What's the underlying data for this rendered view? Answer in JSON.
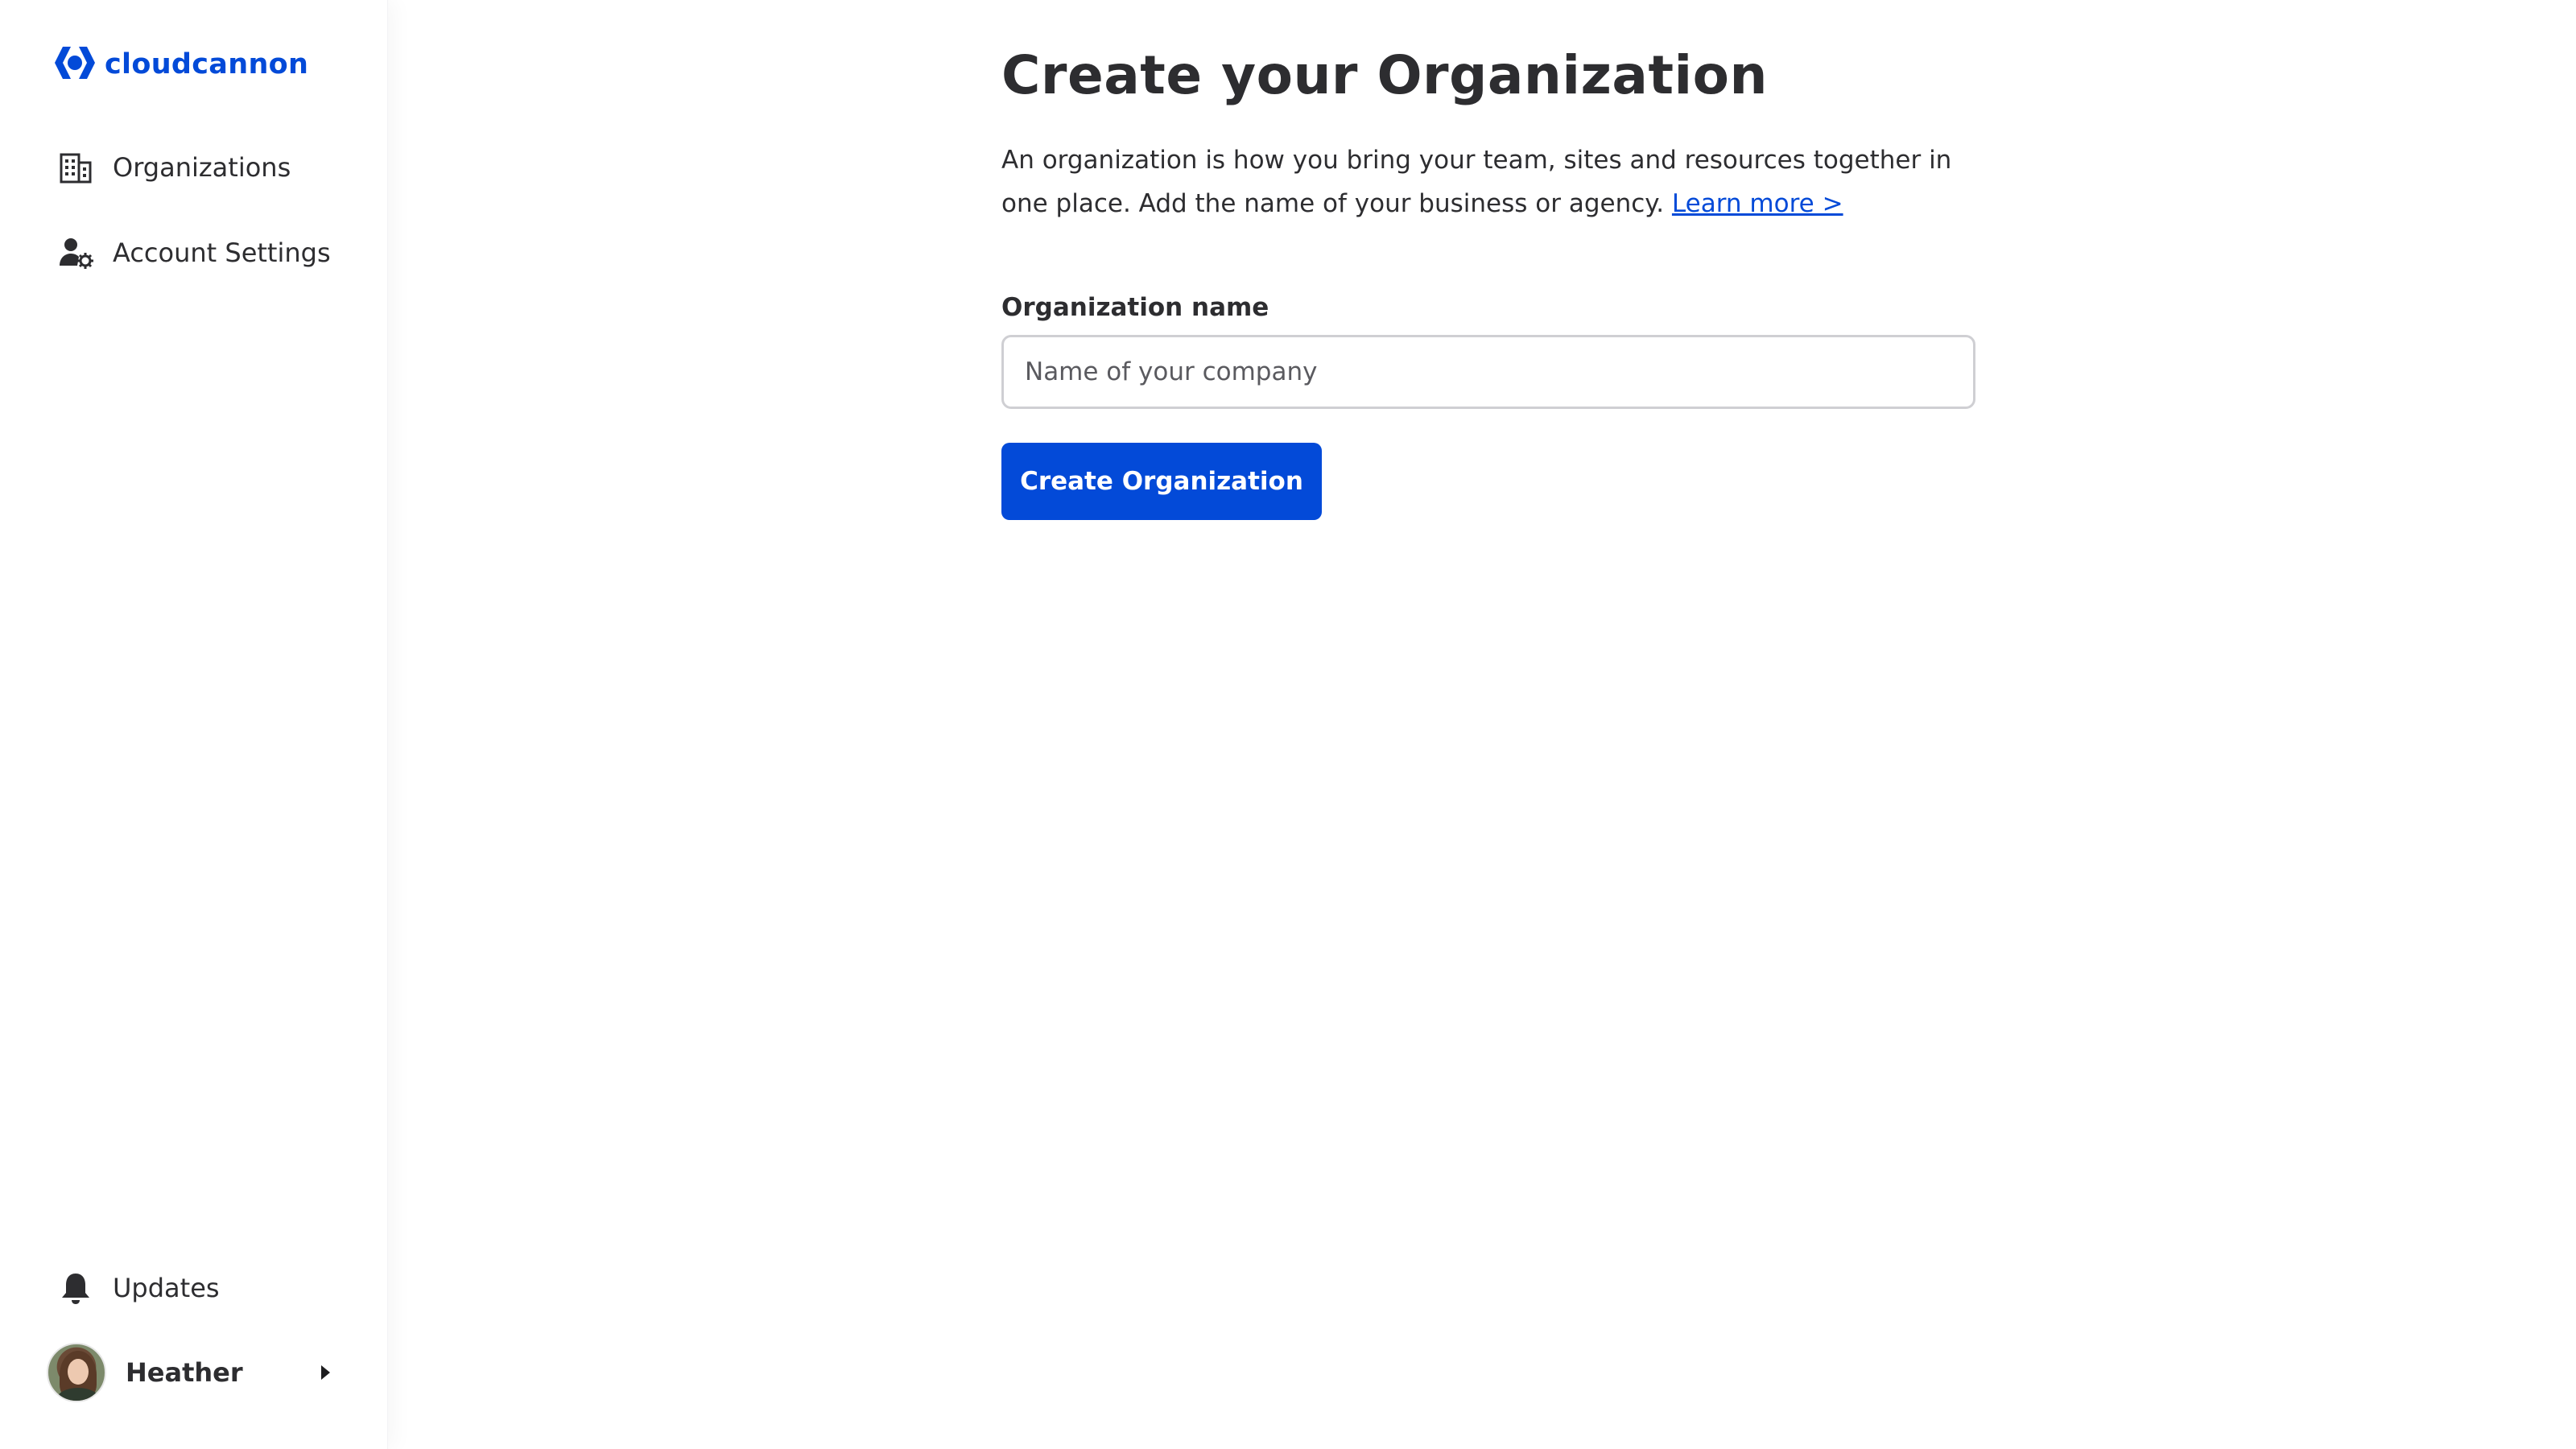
{
  "brand": {
    "name": "cloudcannon",
    "color": "#034ad8",
    "icon": "cloudcannon-logo-icon"
  },
  "sidebar": {
    "items": [
      {
        "label": "Organizations",
        "icon": "building-icon"
      },
      {
        "label": "Account Settings",
        "icon": "user-gear-icon"
      }
    ],
    "bottom": {
      "updates": {
        "label": "Updates",
        "icon": "bell-icon"
      },
      "user": {
        "name": "Heather",
        "icon": "caret-right-icon"
      }
    }
  },
  "main": {
    "title": "Create your Organization",
    "description": "An organization is how you bring your team, sites and resources together in one place. Add the name of your business or agency.",
    "learn_more": "Learn more >",
    "field_label": "Organization name",
    "input": {
      "value": "",
      "placeholder": "Name of your company"
    },
    "submit_label": "Create Organization"
  },
  "colors": {
    "primary": "#034ad8",
    "text": "#2d2d30",
    "input_border": "#cfcfd3"
  }
}
